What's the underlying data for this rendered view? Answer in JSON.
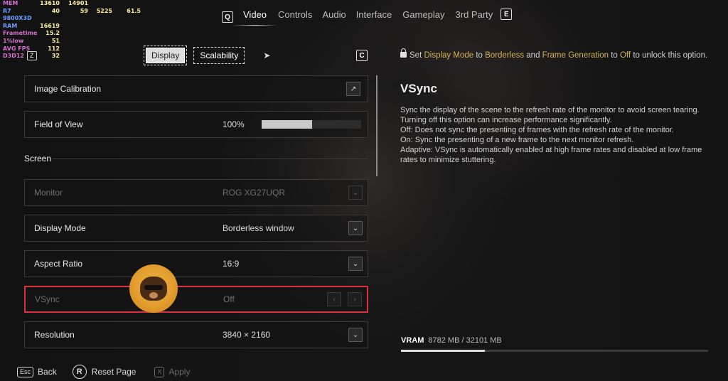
{
  "overlay": {
    "mem": {
      "label": "MEM",
      "v1": "13610",
      "v2": "14901"
    },
    "cpu": {
      "label": "R7 9800X3D",
      "v1": "40",
      "v2": "59",
      "v3": "5225",
      "v4": "61.5"
    },
    "ram": {
      "label": "RAM",
      "v1": "16619"
    },
    "frametime": {
      "label": "Frametime",
      "v1": "15.2"
    },
    "low": {
      "label": "1%low",
      "v1": "51"
    },
    "avgfps": {
      "label": "AVG FPS",
      "v1": "112"
    },
    "api": {
      "label": "D3D12",
      "v1": "32"
    },
    "z_key": "Z"
  },
  "nav": {
    "left_key": "Q",
    "tabs": [
      "Video",
      "Controls",
      "Audio",
      "Interface",
      "Gameplay",
      "3rd Party"
    ],
    "right_key": "E"
  },
  "subtabs": {
    "display": "Display",
    "scalability": "Scalability",
    "c_key": "C"
  },
  "settings": {
    "image_calibration": {
      "label": "Image Calibration"
    },
    "fov": {
      "label": "Field of View",
      "value": "100%",
      "fill_pct": 51
    },
    "section": "Screen",
    "monitor": {
      "label": "Monitor",
      "value": "ROG XG27UQR"
    },
    "display_mode": {
      "label": "Display Mode",
      "value": "Borderless window"
    },
    "aspect_ratio": {
      "label": "Aspect Ratio",
      "value": "16:9"
    },
    "vsync": {
      "label": "VSync",
      "value": "Off"
    },
    "resolution": {
      "label": "Resolution",
      "value": "3840 × 2160"
    }
  },
  "info": {
    "t1": "Set ",
    "h1": "Display Mode",
    "t2": " to ",
    "h2": "Borderless",
    "t3": " and ",
    "h3": "Frame Generation",
    "t4": " to ",
    "h4": "Off",
    "t5": " to unlock this option."
  },
  "description": {
    "title": "VSync",
    "lines": [
      "Sync the display of the scene to the refresh rate of the monitor to avoid screen tearing. Turning off this option can increase performance significantly.",
      "Off: Does not sync the presenting of frames  with the refresh rate of the monitor.",
      "On: Sync the presenting of a new frame to the next monitor refresh.",
      "Adaptive: VSync is automatically enabled at high frame rates and disabled at low frame rates to minimize stuttering."
    ]
  },
  "vram": {
    "label": "VRAM",
    "value": "8782 MB / 32101 MB",
    "used_mb": 8782,
    "total_mb": 32101
  },
  "bottom": {
    "back_key": "Esc",
    "back": "Back",
    "reset_key": "R",
    "reset": "Reset Page",
    "apply_key": "X",
    "apply": "Apply"
  }
}
